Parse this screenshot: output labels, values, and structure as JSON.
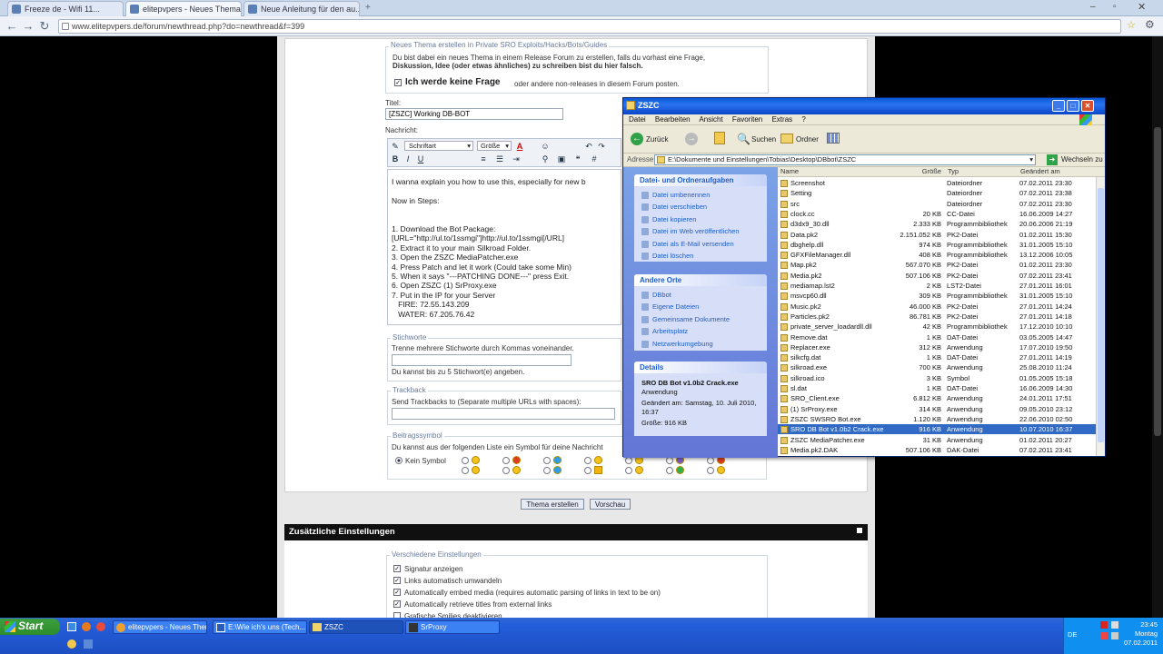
{
  "browser": {
    "tabs": [
      {
        "label": "Freeze de - Wifi 11..."
      },
      {
        "label": "elitepvpers - Neues Thema..."
      },
      {
        "label": "Neue Anleitung für den au..."
      }
    ],
    "url": "www.elitepvpers.de/forum/newthread.php?do=newthread&f=399"
  },
  "form": {
    "header_legend": "Neues Thema erstellen in Private SRO Exploits/Hacks/Bots/Guides",
    "notice_line1": "Du bist dabei ein neues Thema in einem Release Forum zu erstellen, falls du vorhast eine Frage,",
    "notice_line2": "Diskussion, Idee (oder etwas ähnliches) zu schreiben bist du hier falsch.",
    "no_question_bold": "Ich werde keine Frage",
    "no_question_rest": "oder andere non-releases in diesem Forum posten.",
    "title_label": "Titel:",
    "title_value": "[ZSZC] Working DB-BOT",
    "message_label": "Nachricht:",
    "font_select": "Schriftart",
    "size_select": "Größe",
    "editor_text": "I wanna explain you how to use this, especially for new b\n\nNow in Steps:\n\n\n1. Download the Bot Package:\n[URL=\"http://ul.to/1ssmgi\"]http://ul.to/1ssmgi[/URL]\n2. Extract it to your main Silkroad Folder.\n3. Open the ZSZC MediaPatcher.exe\n4. Press Patch and let it work (Could take some Min)\n5. When it says \"---PATCHING DONE---\" press Exit.\n6. Open ZSZC (1) SrProxy.exe\n7. Put in the IP for your Server\n   FIRE: 72.55.143.209\n   WATER: 67.205.76.42",
    "tags_legend": "Stichworte",
    "tags_hint": "Trenne mehrere Stichworte durch Kommas voneinander.",
    "tags_limit": "Du kannst bis zu 5 Stichwort(e) angeben.",
    "trackback_legend": "Trackback",
    "trackback_hint": "Send Trackbacks to (Separate multiple URLs with spaces):",
    "icons_legend": "Beitragssymbol",
    "icons_hint": "Du kannst aus der folgenden Liste ein Symbol für deine Nachricht",
    "no_icon": "Kein Symbol",
    "submit_button": "Thema erstellen",
    "preview_button": "Vorschau"
  },
  "extra_options": {
    "title": "Zusätzliche Einstellungen",
    "legend": "Verschiedene Einstellungen",
    "items": [
      "Signatur anzeigen",
      "Links automatisch umwandeln",
      "Automatically embed media (requires automatic parsing of links in text to be on)",
      "Automatically retrieve titles from external links",
      "Grafische Smilies deaktivieren"
    ]
  },
  "explorer": {
    "title": "ZSZC",
    "menu": [
      "Datei",
      "Bearbeiten",
      "Ansicht",
      "Favoriten",
      "Extras",
      "?"
    ],
    "back": "Zurück",
    "search": "Suchen",
    "folders": "Ordner",
    "address_label": "Adresse",
    "address": "E:\\Dokumente und Einstellungen\\Tobias\\Desktop\\DBbot\\ZSZC",
    "go": "Wechseln zu",
    "file_tasks_title": "Datei- und Ordneraufgaben",
    "file_tasks": [
      "Datei umbenennen",
      "Datei verschieben",
      "Datei kopieren",
      "Datei im Web veröffentlichen",
      "Datei als E-Mail versenden",
      "Datei löschen"
    ],
    "other_title": "Andere Orte",
    "other_places": [
      "DBbot",
      "Eigene Dateien",
      "Gemeinsame Dokumente",
      "Arbeitsplatz",
      "Netzwerkumgebung"
    ],
    "details_title": "Details",
    "details_name": "SRO DB Bot v1.0b2 Crack.exe",
    "details_type": "Anwendung",
    "details_changed": "Geändert am: Samstag, 10. Juli 2010, 16:37",
    "details_size": "Größe: 916 KB",
    "columns": [
      "Name",
      "Größe",
      "Typ",
      "Geändert am"
    ],
    "files": [
      [
        "Screenshot",
        "",
        "Dateiordner",
        "07.02.2011 23:30"
      ],
      [
        "Setting",
        "",
        "Dateiordner",
        "07.02.2011 23:38"
      ],
      [
        "src",
        "",
        "Dateiordner",
        "07.02.2011 23:30"
      ],
      [
        "clock.cc",
        "20 KB",
        "CC-Datei",
        "16.06.2009 14:27"
      ],
      [
        "d3dx9_30.dll",
        "2.333 KB",
        "Programmbibliothek",
        "20.06.2006 21:19"
      ],
      [
        "Data.pk2",
        "2.151.052 KB",
        "PK2-Datei",
        "01.02.2011 15:30"
      ],
      [
        "dbghelp.dll",
        "974 KB",
        "Programmbibliothek",
        "31.01.2005 15:10"
      ],
      [
        "GFXFileManager.dll",
        "408 KB",
        "Programmbibliothek",
        "13.12.2006 10:05"
      ],
      [
        "Map.pk2",
        "567.070 KB",
        "PK2-Datei",
        "01.02.2011 23:30"
      ],
      [
        "Media.pk2",
        "507.106 KB",
        "PK2-Datei",
        "07.02.2011 23:41"
      ],
      [
        "mediamap.lst2",
        "2 KB",
        "LST2-Datei",
        "27.01.2011 16:01"
      ],
      [
        "msvcp60.dll",
        "309 KB",
        "Programmbibliothek",
        "31.01.2005 15:10"
      ],
      [
        "Music.pk2",
        "46.000 KB",
        "PK2-Datei",
        "27.01.2011 14:24"
      ],
      [
        "Particles.pk2",
        "86.781 KB",
        "PK2-Datei",
        "27.01.2011 14:18"
      ],
      [
        "private_server_loadardll.dll",
        "42 KB",
        "Programmbibliothek",
        "17.12.2010 10:10"
      ],
      [
        "Remove.dat",
        "1 KB",
        "DAT-Datei",
        "03.05.2005 14:47"
      ],
      [
        "Replacer.exe",
        "312 KB",
        "Anwendung",
        "17.07.2010 19:50"
      ],
      [
        "silkcfg.dat",
        "1 KB",
        "DAT-Datei",
        "27.01.2011 14:19"
      ],
      [
        "silkroad.exe",
        "700 KB",
        "Anwendung",
        "25.08.2010 11:24"
      ],
      [
        "silkroad.ico",
        "3 KB",
        "Symbol",
        "01.05.2005 15:18"
      ],
      [
        "sl.dat",
        "1 KB",
        "DAT-Datei",
        "16.06.2009 14:30"
      ],
      [
        "SRO_Client.exe",
        "6.812 KB",
        "Anwendung",
        "24.01.2011 17:51"
      ],
      [
        "(1) SrProxy.exe",
        "314 KB",
        "Anwendung",
        "09.05.2010 23:12"
      ],
      [
        "ZSZC SWSRO Bot.exe",
        "1.120 KB",
        "Anwendung",
        "22.06.2010 02:50"
      ],
      [
        "SRO DB Bot v1.0b2 Crack.exe",
        "916 KB",
        "Anwendung",
        "10.07.2010 16:37"
      ],
      [
        "ZSZC MediaPatcher.exe",
        "31 KB",
        "Anwendung",
        "01.02.2011 20:27"
      ],
      [
        "Media.pk2.DAK",
        "507.106 KB",
        "DAK-Datei",
        "07.02.2011 23:41"
      ]
    ],
    "selected_index": 24
  },
  "taskbar": {
    "start": "Start",
    "buttons": [
      "elitepvpers - Neues Them...",
      "E:\\Wie ich's uns (Tech...",
      "ZSZC",
      "SrProxy"
    ],
    "time": "23:45",
    "day": "Montag",
    "date": "07.02.2011",
    "lang": "DE"
  }
}
